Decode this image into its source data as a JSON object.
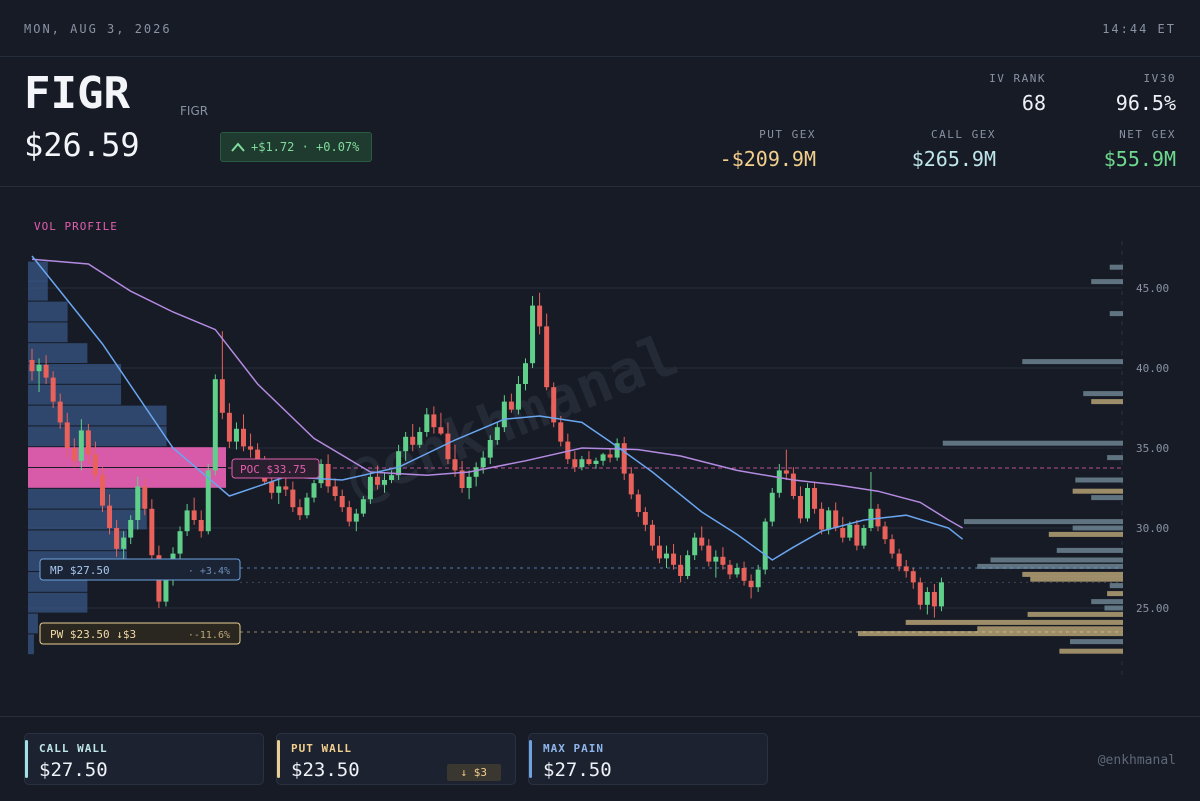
{
  "topbar": {
    "date": "MON, AUG 3, 2026",
    "time": "14:44 ET"
  },
  "header": {
    "ticker": "FIGR",
    "subticker": "FIGR",
    "price": "$26.59",
    "change": "+$1.72 · +0.07%",
    "iv_rank_label": "IV RANK",
    "iv_rank": "68",
    "iv30_label": "IV30",
    "iv30": "96.5%",
    "put_gex_label": "PUT GEX",
    "put_gex": "-$209.9M",
    "call_gex_label": "CALL GEX",
    "call_gex": "$265.9M",
    "net_gex_label": "NET GEX",
    "net_gex": "$55.9M"
  },
  "colors": {
    "up": "#5fcf8a",
    "down": "#e8625b",
    "poc": "#e35fb0",
    "mp": "#6fa3e0",
    "pw": "#e9cf92",
    "sma_blue": "#6aa6f0",
    "sma_purple": "#b48ae0"
  },
  "chart_data": {
    "type": "candlestick",
    "title": "",
    "y_ticks": [
      "45.00",
      "40.00",
      "35.00",
      "30.00",
      "25.00"
    ],
    "ylim": [
      21.5,
      47
    ],
    "vol_profile_label": "VOL PROFILE",
    "poc_label": "POC $33.75",
    "poc": 33.75,
    "mp_label": "MP $27.50",
    "mp_pct": "· +3.4%",
    "mp": 27.5,
    "pw_label": "PW $23.50 ↓$3",
    "pw_pct": "·-11.6%",
    "pw": 23.5,
    "watermark": "@enkhmanal",
    "candles": [
      [
        40.5,
        41.2,
        39.2,
        39.8
      ],
      [
        39.8,
        40.6,
        38.5,
        40.2
      ],
      [
        40.2,
        40.8,
        39.0,
        39.4
      ],
      [
        39.4,
        39.8,
        37.5,
        37.9
      ],
      [
        37.9,
        38.4,
        36.2,
        36.6
      ],
      [
        36.6,
        37.2,
        34.4,
        35.0
      ],
      [
        35.0,
        35.6,
        33.8,
        34.2
      ],
      [
        34.2,
        36.8,
        33.6,
        36.1
      ],
      [
        36.1,
        36.5,
        34.0,
        34.6
      ],
      [
        34.6,
        35.4,
        32.9,
        33.3
      ],
      [
        33.3,
        33.8,
        31.0,
        31.4
      ],
      [
        31.4,
        32.1,
        29.6,
        30.0
      ],
      [
        30.0,
        30.5,
        28.2,
        28.7
      ],
      [
        28.7,
        29.8,
        28.0,
        29.4
      ],
      [
        29.4,
        30.8,
        29.0,
        30.5
      ],
      [
        30.5,
        33.2,
        29.9,
        32.6
      ],
      [
        32.6,
        33.1,
        30.8,
        31.2
      ],
      [
        31.2,
        31.8,
        27.9,
        28.3
      ],
      [
        28.3,
        28.9,
        25.0,
        25.4
      ],
      [
        25.4,
        27.6,
        25.1,
        27.2
      ],
      [
        27.2,
        28.8,
        26.4,
        28.4
      ],
      [
        28.4,
        30.1,
        28.0,
        29.8
      ],
      [
        29.8,
        31.5,
        29.5,
        31.1
      ],
      [
        31.1,
        31.9,
        30.2,
        30.5
      ],
      [
        30.5,
        31.1,
        29.4,
        29.8
      ],
      [
        29.8,
        34.0,
        29.6,
        33.6
      ],
      [
        33.6,
        39.6,
        33.3,
        39.3
      ],
      [
        39.3,
        42.3,
        36.8,
        37.2
      ],
      [
        37.2,
        37.8,
        35.0,
        35.4
      ],
      [
        35.4,
        36.6,
        34.9,
        36.2
      ],
      [
        36.2,
        37.1,
        34.8,
        35.1
      ],
      [
        35.1,
        35.9,
        34.4,
        34.9
      ],
      [
        34.9,
        35.3,
        33.6,
        34.1
      ],
      [
        34.1,
        34.5,
        32.7,
        32.9
      ],
      [
        32.9,
        33.4,
        31.8,
        32.2
      ],
      [
        32.2,
        33.0,
        31.5,
        32.6
      ],
      [
        32.6,
        33.3,
        32.0,
        32.4
      ],
      [
        32.4,
        32.9,
        31.0,
        31.3
      ],
      [
        31.3,
        31.8,
        30.5,
        30.8
      ],
      [
        30.8,
        32.2,
        30.6,
        31.9
      ],
      [
        31.9,
        33.0,
        31.6,
        32.8
      ],
      [
        32.8,
        34.3,
        32.5,
        34.0
      ],
      [
        34.0,
        34.6,
        32.2,
        32.6
      ],
      [
        32.6,
        33.1,
        31.7,
        32.0
      ],
      [
        32.0,
        32.4,
        31.0,
        31.3
      ],
      [
        31.3,
        31.7,
        30.1,
        30.4
      ],
      [
        30.4,
        31.2,
        29.8,
        30.9
      ],
      [
        30.9,
        32.0,
        30.7,
        31.8
      ],
      [
        31.8,
        33.4,
        31.5,
        33.2
      ],
      [
        33.2,
        33.9,
        32.4,
        32.7
      ],
      [
        32.7,
        33.5,
        32.2,
        33.0
      ],
      [
        33.0,
        33.6,
        32.8,
        33.3
      ],
      [
        33.3,
        35.2,
        33.0,
        34.8
      ],
      [
        34.8,
        36.0,
        34.2,
        35.7
      ],
      [
        35.7,
        36.5,
        34.8,
        35.2
      ],
      [
        35.2,
        36.3,
        35.0,
        36.0
      ],
      [
        36.0,
        37.5,
        35.7,
        37.1
      ],
      [
        37.1,
        37.6,
        35.9,
        36.3
      ],
      [
        36.3,
        37.2,
        35.8,
        35.9
      ],
      [
        35.9,
        36.6,
        34.0,
        34.3
      ],
      [
        34.3,
        35.2,
        33.2,
        33.6
      ],
      [
        33.6,
        34.2,
        32.2,
        32.5
      ],
      [
        32.5,
        33.6,
        31.8,
        33.2
      ],
      [
        33.2,
        34.1,
        32.6,
        33.8
      ],
      [
        33.8,
        34.8,
        33.4,
        34.4
      ],
      [
        34.4,
        35.8,
        34.0,
        35.5
      ],
      [
        35.5,
        36.6,
        35.2,
        36.3
      ],
      [
        36.3,
        38.3,
        36.0,
        37.9
      ],
      [
        37.9,
        38.4,
        37.2,
        37.4
      ],
      [
        37.4,
        39.5,
        37.1,
        39.0
      ],
      [
        39.0,
        40.6,
        38.6,
        40.3
      ],
      [
        40.3,
        44.5,
        40.0,
        43.9
      ],
      [
        43.9,
        44.7,
        42.1,
        42.6
      ],
      [
        42.6,
        43.4,
        38.6,
        38.8
      ],
      [
        38.8,
        39.1,
        36.3,
        36.6
      ],
      [
        36.6,
        37.0,
        35.1,
        35.4
      ],
      [
        35.4,
        35.9,
        34.0,
        34.3
      ],
      [
        34.3,
        34.8,
        33.5,
        33.8
      ],
      [
        33.8,
        34.5,
        33.6,
        34.3
      ],
      [
        34.3,
        34.8,
        33.9,
        34.0
      ],
      [
        34.0,
        34.4,
        33.7,
        34.2
      ],
      [
        34.2,
        34.7,
        33.9,
        34.6
      ],
      [
        34.6,
        35.0,
        34.1,
        34.4
      ],
      [
        34.4,
        35.6,
        34.2,
        35.3
      ],
      [
        35.3,
        35.7,
        33.0,
        33.4
      ],
      [
        33.4,
        33.8,
        31.8,
        32.1
      ],
      [
        32.1,
        32.4,
        30.7,
        31.0
      ],
      [
        31.0,
        31.3,
        29.8,
        30.2
      ],
      [
        30.2,
        30.5,
        28.6,
        28.9
      ],
      [
        28.9,
        29.5,
        27.8,
        28.1
      ],
      [
        28.1,
        28.9,
        27.5,
        28.4
      ],
      [
        28.4,
        29.0,
        27.4,
        27.7
      ],
      [
        27.7,
        28.3,
        26.6,
        27.0
      ],
      [
        27.0,
        28.6,
        26.8,
        28.3
      ],
      [
        28.3,
        29.7,
        28.0,
        29.4
      ],
      [
        29.4,
        30.1,
        28.6,
        28.9
      ],
      [
        28.9,
        29.3,
        27.6,
        27.9
      ],
      [
        27.9,
        28.6,
        26.9,
        28.2
      ],
      [
        28.2,
        28.8,
        27.4,
        27.7
      ],
      [
        27.7,
        28.0,
        26.8,
        27.1
      ],
      [
        27.1,
        27.8,
        26.9,
        27.5
      ],
      [
        27.5,
        27.9,
        26.4,
        26.7
      ],
      [
        26.7,
        27.1,
        25.6,
        26.3
      ],
      [
        26.3,
        27.7,
        26.0,
        27.4
      ],
      [
        27.4,
        30.6,
        27.1,
        30.4
      ],
      [
        30.4,
        32.5,
        30.1,
        32.2
      ],
      [
        32.2,
        34.0,
        31.9,
        33.6
      ],
      [
        33.6,
        34.9,
        33.0,
        33.4
      ],
      [
        33.4,
        33.8,
        31.8,
        32.0
      ],
      [
        32.0,
        32.6,
        30.3,
        30.6
      ],
      [
        30.6,
        32.8,
        30.4,
        32.5
      ],
      [
        32.5,
        32.9,
        30.9,
        31.2
      ],
      [
        31.2,
        31.6,
        29.6,
        29.9
      ],
      [
        29.9,
        31.3,
        29.6,
        31.1
      ],
      [
        31.1,
        31.6,
        29.8,
        30.0
      ],
      [
        30.0,
        30.7,
        29.1,
        29.4
      ],
      [
        29.4,
        30.4,
        29.2,
        30.2
      ],
      [
        30.2,
        30.5,
        28.6,
        28.9
      ],
      [
        28.9,
        30.2,
        28.7,
        30.0
      ],
      [
        30.0,
        33.5,
        29.8,
        31.2
      ],
      [
        31.2,
        31.5,
        29.8,
        30.1
      ],
      [
        30.1,
        30.4,
        29.0,
        29.3
      ],
      [
        29.3,
        29.6,
        28.1,
        28.4
      ],
      [
        28.4,
        28.7,
        27.3,
        27.6
      ],
      [
        27.6,
        28.0,
        26.9,
        27.3
      ],
      [
        27.3,
        27.5,
        26.2,
        26.6
      ],
      [
        26.6,
        26.9,
        24.9,
        25.2
      ],
      [
        25.2,
        26.3,
        24.6,
        26.0
      ],
      [
        26.0,
        26.5,
        24.4,
        25.1
      ],
      [
        25.1,
        26.9,
        24.8,
        26.6
      ]
    ],
    "sma_fast": [
      [
        0,
        47.0
      ],
      [
        10,
        41.5
      ],
      [
        20,
        35.0
      ],
      [
        28,
        32.0
      ],
      [
        36,
        33.2
      ],
      [
        44,
        33.0
      ],
      [
        52,
        33.8
      ],
      [
        60,
        35.5
      ],
      [
        67,
        36.8
      ],
      [
        72,
        37.0
      ],
      [
        78,
        36.6
      ],
      [
        82,
        35.4
      ],
      [
        88,
        33.5
      ],
      [
        95,
        31.0
      ],
      [
        100,
        29.6
      ],
      [
        105,
        28.0
      ],
      [
        108,
        28.8
      ],
      [
        112,
        29.8
      ],
      [
        118,
        30.5
      ],
      [
        124,
        30.8
      ],
      [
        130,
        30.0
      ],
      [
        132,
        29.3
      ]
    ],
    "sma_slow": [
      [
        0,
        46.8
      ],
      [
        8,
        46.5
      ],
      [
        14,
        44.8
      ],
      [
        20,
        43.5
      ],
      [
        26,
        42.4
      ],
      [
        32,
        39.0
      ],
      [
        40,
        35.6
      ],
      [
        48,
        33.5
      ],
      [
        56,
        33.3
      ],
      [
        62,
        33.5
      ],
      [
        70,
        34.2
      ],
      [
        78,
        35.0
      ],
      [
        86,
        34.9
      ],
      [
        92,
        34.5
      ],
      [
        100,
        33.6
      ],
      [
        108,
        33.0
      ],
      [
        114,
        32.7
      ],
      [
        120,
        32.3
      ],
      [
        126,
        31.6
      ],
      [
        130,
        30.5
      ],
      [
        132,
        30.0
      ]
    ],
    "vol_profile": [
      [
        46.0,
        0.1
      ],
      [
        44.8,
        0.1
      ],
      [
        43.5,
        0.2
      ],
      [
        42.2,
        0.2
      ],
      [
        40.9,
        0.3
      ],
      [
        39.6,
        0.47
      ],
      [
        38.3,
        0.47
      ],
      [
        37.0,
        0.7
      ],
      [
        35.7,
        0.7
      ],
      [
        34.4,
        1.0
      ],
      [
        33.1,
        1.0
      ],
      [
        31.8,
        0.6
      ],
      [
        30.5,
        0.6
      ],
      [
        29.2,
        0.5
      ],
      [
        27.9,
        0.5
      ],
      [
        26.6,
        0.3
      ],
      [
        25.3,
        0.3
      ],
      [
        24.0,
        0.05
      ],
      [
        22.7,
        0.03
      ]
    ],
    "gex_bars": [
      [
        46.3,
        0.05,
        "c"
      ],
      [
        45.4,
        0.12,
        "c"
      ],
      [
        43.4,
        0.05,
        "c"
      ],
      [
        40.4,
        0.38,
        "c"
      ],
      [
        38.4,
        0.15,
        "c"
      ],
      [
        37.9,
        0.12,
        "p"
      ],
      [
        35.3,
        0.68,
        "c"
      ],
      [
        34.4,
        0.06,
        "c"
      ],
      [
        33.0,
        0.18,
        "c"
      ],
      [
        32.3,
        0.19,
        "p"
      ],
      [
        31.9,
        0.12,
        "c"
      ],
      [
        30.4,
        0.6,
        "c"
      ],
      [
        30.0,
        0.19,
        "c"
      ],
      [
        29.6,
        0.28,
        "p"
      ],
      [
        28.6,
        0.25,
        "c"
      ],
      [
        28.0,
        0.5,
        "c"
      ],
      [
        27.6,
        0.55,
        "c"
      ],
      [
        27.1,
        0.38,
        "p"
      ],
      [
        26.8,
        0.35,
        "p"
      ],
      [
        26.4,
        0.05,
        "c"
      ],
      [
        25.9,
        0.06,
        "p"
      ],
      [
        25.4,
        0.12,
        "c"
      ],
      [
        25.0,
        0.07,
        "c"
      ],
      [
        24.6,
        0.36,
        "p"
      ],
      [
        24.1,
        0.82,
        "p"
      ],
      [
        23.7,
        0.55,
        "p"
      ],
      [
        23.4,
        1.0,
        "p"
      ],
      [
        22.9,
        0.2,
        "c"
      ],
      [
        22.3,
        0.24,
        "p"
      ]
    ]
  },
  "footer": {
    "call_wall_label": "CALL WALL",
    "call_wall": "$27.50",
    "put_wall_label": "PUT WALL",
    "put_wall": "$23.50",
    "put_wall_badge": "↓ $3",
    "max_pain_label": "MAX PAIN",
    "max_pain": "$27.50",
    "handle": "@enkhmanal"
  }
}
